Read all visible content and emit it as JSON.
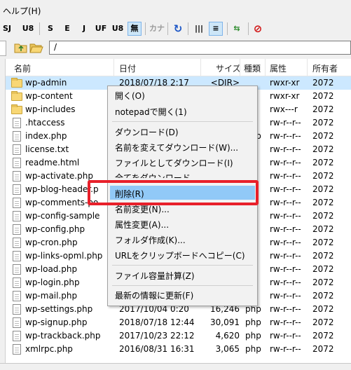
{
  "menubar": {
    "help": "ヘルプ(H)"
  },
  "toolbar": {
    "buttons": [
      "SJ",
      "U8",
      "S",
      "E",
      "J",
      "UF",
      "U8",
      "無",
      "カナ",
      "↻",
      "|||",
      "≡",
      "⇆",
      "⊘"
    ]
  },
  "address": {
    "path": "/"
  },
  "columns": {
    "name": "名前",
    "date": "日付",
    "size": "サイズ",
    "type": "種類",
    "attr": "属性",
    "owner": "所有者"
  },
  "files": [
    {
      "name": "wp-admin",
      "date": "2018/07/18 2:17",
      "size": "<DIR>",
      "type": "",
      "attr": "rwxr-xr",
      "owner": "2072",
      "kind": "folder"
    },
    {
      "name": "wp-content",
      "date": "",
      "size": "",
      "type": "",
      "attr": "rwxr-xr",
      "owner": "2072",
      "kind": "folder"
    },
    {
      "name": "wp-includes",
      "date": "",
      "size": "",
      "type": "",
      "attr": "rwx---r",
      "owner": "2072",
      "kind": "folder"
    },
    {
      "name": ".htaccess",
      "date": "",
      "size": "",
      "type": "",
      "attr": "rw-r--r--",
      "owner": "2072",
      "kind": "file"
    },
    {
      "name": "index.php",
      "date": "",
      "size": "",
      "type": "php",
      "attr": "rw-r--r--",
      "owner": "2072",
      "kind": "file"
    },
    {
      "name": "license.txt",
      "date": "",
      "size": "",
      "type": "",
      "attr": "rw-r--r--",
      "owner": "2072",
      "kind": "file"
    },
    {
      "name": "readme.html",
      "date": "",
      "size": "",
      "type": "",
      "attr": "rw-r--r--",
      "owner": "2072",
      "kind": "file"
    },
    {
      "name": "wp-activate.php",
      "date": "",
      "size": "",
      "type": "",
      "attr": "rw-r--r--",
      "owner": "2072",
      "kind": "file"
    },
    {
      "name": "wp-blog-header.p",
      "date": "",
      "size": "",
      "type": "",
      "attr": "rw-r--r--",
      "owner": "2072",
      "kind": "file"
    },
    {
      "name": "wp-comments-po",
      "date": "",
      "size": "",
      "type": "",
      "attr": "rw-r--r--",
      "owner": "2072",
      "kind": "file"
    },
    {
      "name": "wp-config-sample",
      "date": "",
      "size": "",
      "type": "",
      "attr": "rw-r--r--",
      "owner": "2072",
      "kind": "file"
    },
    {
      "name": "wp-config.php",
      "date": "",
      "size": "",
      "type": "",
      "attr": "rw-r--r--",
      "owner": "2072",
      "kind": "file"
    },
    {
      "name": "wp-cron.php",
      "date": "",
      "size": "",
      "type": "",
      "attr": "rw-r--r--",
      "owner": "2072",
      "kind": "file"
    },
    {
      "name": "wp-links-opml.php",
      "date": "",
      "size": "",
      "type": "",
      "attr": "rw-r--r--",
      "owner": "2072",
      "kind": "file"
    },
    {
      "name": "wp-load.php",
      "date": "",
      "size": "",
      "type": "",
      "attr": "rw-r--r--",
      "owner": "2072",
      "kind": "file"
    },
    {
      "name": "wp-login.php",
      "date": "",
      "size": "",
      "type": "",
      "attr": "rw-r--r--",
      "owner": "2072",
      "kind": "file"
    },
    {
      "name": "wp-mail.php",
      "date": "",
      "size": "",
      "type": "",
      "attr": "rw-r--r--",
      "owner": "2072",
      "kind": "file"
    },
    {
      "name": "wp-settings.php",
      "date": "2017/10/04 0:20",
      "size": "16,246",
      "type": "php",
      "attr": "rw-r--r--",
      "owner": "2072",
      "kind": "file"
    },
    {
      "name": "wp-signup.php",
      "date": "2018/07/18 12:44",
      "size": "30,091",
      "type": "php",
      "attr": "rw-r--r--",
      "owner": "2072",
      "kind": "file"
    },
    {
      "name": "wp-trackback.php",
      "date": "2017/10/23 22:12",
      "size": "4,620",
      "type": "php",
      "attr": "rw-r--r--",
      "owner": "2072",
      "kind": "file"
    },
    {
      "name": "xmlrpc.php",
      "date": "2016/08/31 16:31",
      "size": "3,065",
      "type": "php",
      "attr": "rw-r--r--",
      "owner": "2072",
      "kind": "file"
    }
  ],
  "context_menu": {
    "open": "開く(O)",
    "open_notepad": "notepadで開く(1)",
    "download": "ダウンロード(D)",
    "rename_download": "名前を変えてダウンロード(W)...",
    "download_as_file": "ファイルとしてダウンロード(I)",
    "download_all": "全てをダウンロード",
    "delete": "削除(R)",
    "rename": "名前変更(N)...",
    "chmod": "属性変更(A)...",
    "mkdir": "フォルダ作成(K)...",
    "copy_url": "URLをクリップボードへコピー(C)",
    "calc_size": "ファイル容量計算(Z)",
    "refresh": "最新の情報に更新(F)"
  },
  "colors": {
    "highlight": "#91c9f7",
    "selection": "#cce8ff",
    "annotation": "#e8202a"
  }
}
